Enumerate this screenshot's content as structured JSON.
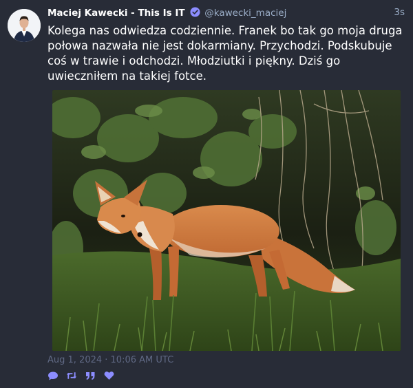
{
  "status": {
    "display_name": "Maciej Kawecki - This Is IT",
    "handle": "@kawecki_maciej",
    "relative_time": "3s",
    "content": "Kolega nas odwiedza codziennie. Franek bo tak go moja druga połowa nazwała nie jest dokarmiany. Przychodzi. Podskubuje coś w trawie i odchodzi. Młodziutki i piękny. Dziś go uwieczniłem na takiej fotce.",
    "date": "Aug 1, 2024 · 10:06 AM UTC"
  },
  "icons": {
    "verified": "verified-badge-icon",
    "reply": "speech-bubble-icon",
    "boost": "retweet-icon",
    "quote": "quote-icon",
    "favourite": "heart-icon"
  },
  "colors": {
    "background": "#282c37",
    "muted_text": "#9baec8",
    "date_text": "#606984",
    "accent": "#8c8dff"
  }
}
